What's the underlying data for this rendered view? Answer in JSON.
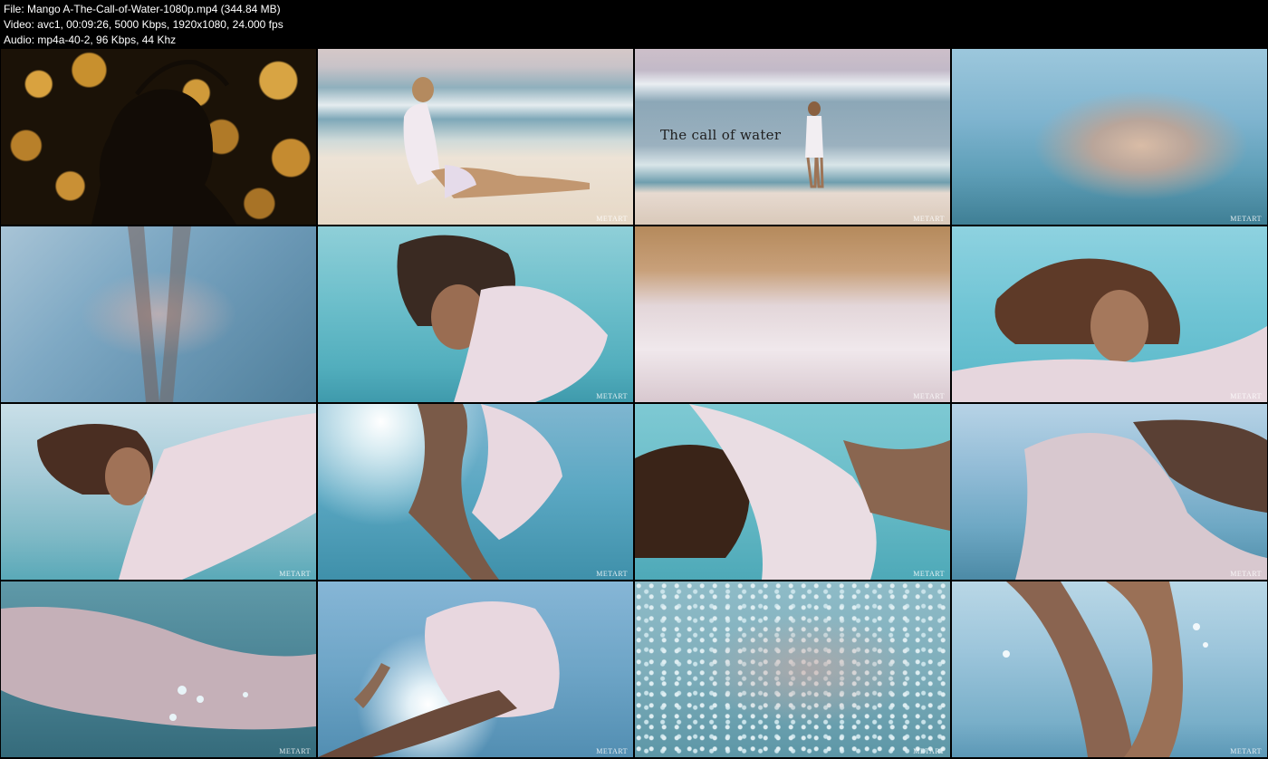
{
  "file_info": {
    "file_line": "File: Mango A-The-Call-of-Water-1080p.mp4 (344.84 MB)",
    "video_line": "Video: avc1, 00:09:26, 5000 Kbps, 1920x1080, 24.000 fps",
    "audio_line": "Audio: mp4a-40-2, 96 Kbps, 44 Khz"
  },
  "watermark": "METART",
  "frames": [
    {
      "scene": "bokeh-silhouette"
    },
    {
      "scene": "beach-sitting"
    },
    {
      "scene": "beach-standing",
      "title_text": "The call of water"
    },
    {
      "scene": "underwater-surface"
    },
    {
      "scene": "underwater-legs"
    },
    {
      "scene": "underwater-portrait"
    },
    {
      "scene": "underwater-fabric-closeup"
    },
    {
      "scene": "underwater-smile"
    },
    {
      "scene": "underwater-arms-up"
    },
    {
      "scene": "underwater-sunrays"
    },
    {
      "scene": "underwater-hair"
    },
    {
      "scene": "underwater-sky-bubbles"
    },
    {
      "scene": "underwater-bubbles-dark"
    },
    {
      "scene": "underwater-sun-fabric"
    },
    {
      "scene": "underwater-bubbles-dense"
    },
    {
      "scene": "underwater-legs-bubbles"
    }
  ]
}
